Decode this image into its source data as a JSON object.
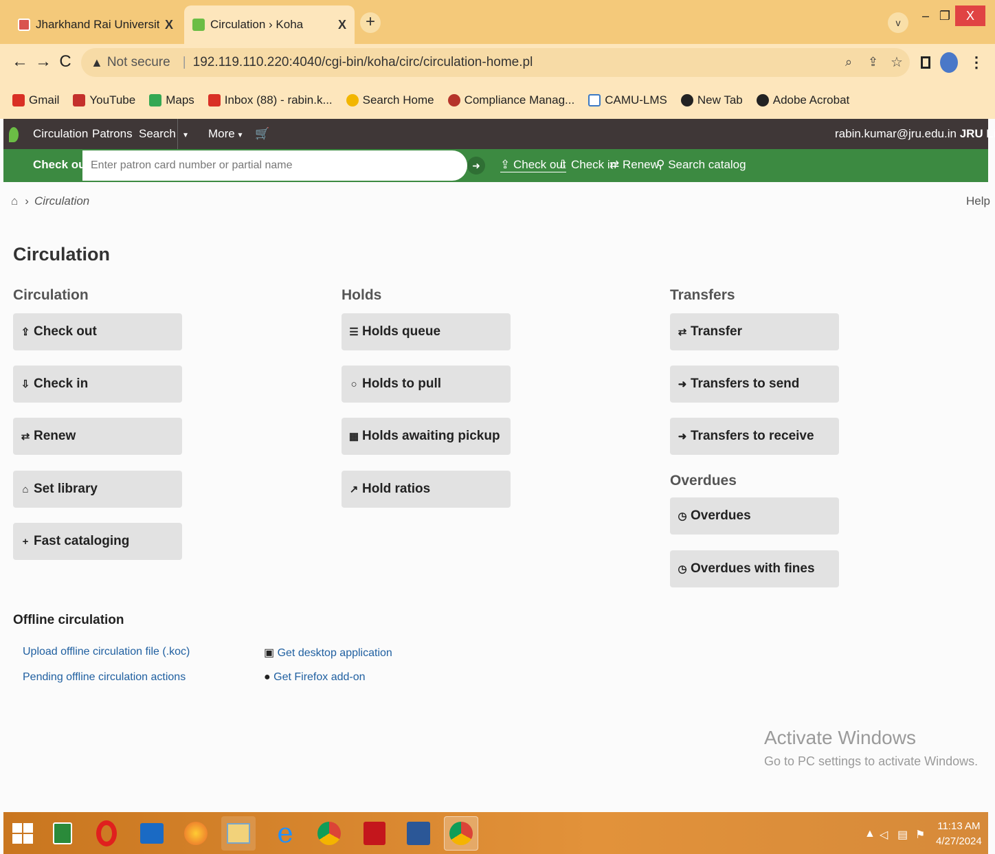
{
  "browser": {
    "tabs": [
      {
        "title": "Jharkhand Rai University (JRU), R",
        "close": "X"
      },
      {
        "title": "Circulation › Koha",
        "close": "X"
      }
    ],
    "new_tab": "+",
    "tab_search": "v",
    "window": {
      "minimize": "–",
      "restore": "❐",
      "close": "X"
    },
    "nav": {
      "back": "←",
      "forward": "→",
      "reload": "C"
    },
    "address": {
      "security": "Not secure",
      "url": "192.119.110.220:4040/cgi-bin/koha/circ/circulation-home.pl"
    },
    "bookmarks": [
      {
        "label": "Gmail",
        "color": "#d93025"
      },
      {
        "label": "YouTube",
        "color": "#c4302b"
      },
      {
        "label": "Maps",
        "color": "#34a853"
      },
      {
        "label": "Inbox (88) - rabin.k...",
        "color": "#d93025"
      },
      {
        "label": "Search Home",
        "color": "#f2b600"
      },
      {
        "label": "Compliance Manag...",
        "color": "#b5342b"
      },
      {
        "label": "CAMU-LMS",
        "color": "#3b79c4"
      },
      {
        "label": "New Tab",
        "color": "#222222"
      },
      {
        "label": "Adobe Acrobat",
        "color": "#222222"
      }
    ]
  },
  "koha_nav": {
    "items": [
      "Circulation",
      "Patrons",
      "Search",
      "More"
    ],
    "user": "rabin.kumar@jru.edu.in",
    "library": "JRU Library"
  },
  "search_bar": {
    "label": "Check out",
    "placeholder": "Enter patron card number or partial name",
    "links": [
      "Check out",
      "Check in",
      "Renew",
      "Search catalog"
    ]
  },
  "breadcrumb": {
    "current": "Circulation"
  },
  "help": "Help",
  "page_title": "Circulation",
  "columns": {
    "circulation": {
      "heading": "Circulation",
      "buttons": [
        {
          "label": "Check out",
          "icon": "upload-icon"
        },
        {
          "label": "Check in",
          "icon": "download-icon"
        },
        {
          "label": "Renew",
          "icon": "retweet-icon"
        },
        {
          "label": "Set library",
          "icon": "home-icon"
        },
        {
          "label": "Fast cataloging",
          "icon": "plus-icon"
        }
      ]
    },
    "holds": {
      "heading": "Holds",
      "buttons": [
        {
          "label": "Holds queue",
          "icon": "list-icon"
        },
        {
          "label": "Holds to pull",
          "icon": "hand-icon"
        },
        {
          "label": "Holds awaiting pickup",
          "icon": "calendar-icon"
        },
        {
          "label": "Hold ratios",
          "icon": "line-chart-icon"
        }
      ]
    },
    "transfers": {
      "heading": "Transfers",
      "buttons": [
        {
          "label": "Transfer",
          "icon": "exchange-icon"
        },
        {
          "label": "Transfers to send",
          "icon": "sign-out-icon"
        },
        {
          "label": "Transfers to receive",
          "icon": "sign-in-icon"
        }
      ]
    },
    "overdues": {
      "heading": "Overdues",
      "buttons": [
        {
          "label": "Overdues",
          "icon": "clock-icon"
        },
        {
          "label": "Overdues with fines",
          "icon": "clock-icon"
        }
      ]
    }
  },
  "offline": {
    "heading": "Offline circulation",
    "links": [
      "Upload offline circulation file (.koc)",
      "Pending offline circulation actions",
      "Get desktop application",
      "Get Firefox add-on"
    ]
  },
  "watermark": {
    "line1": "Activate Windows",
    "line2": "Go to PC settings to activate Windows."
  },
  "taskbar": {
    "time": "11:13 AM",
    "date": "4/27/2024"
  }
}
